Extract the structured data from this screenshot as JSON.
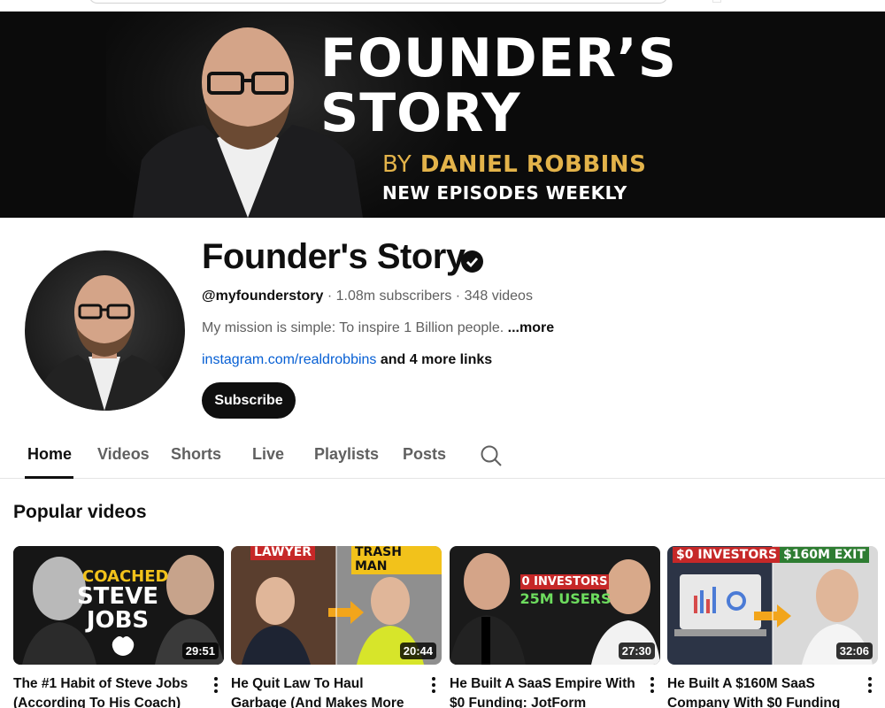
{
  "banner": {
    "title_line1": "FOUNDER’S",
    "title_line2": "STORY",
    "by": "BY",
    "author": "DANIEL ROBBINS",
    "tagline": "NEW EPISODES WEEKLY"
  },
  "channel": {
    "name": "Founder's Story",
    "handle": "@myfounderstory",
    "stats": " · 1.08m subscribers · 348 videos",
    "description": "My mission is simple: To inspire 1 Billion people. ",
    "description_more": "...more",
    "link": "instagram.com/realdrobbins",
    "more_links": " and 4 more links",
    "subscribe_label": "Subscribe"
  },
  "tabs": [
    {
      "label": "Home",
      "active": true
    },
    {
      "label": "Videos"
    },
    {
      "label": "Shorts"
    },
    {
      "label": "Live"
    },
    {
      "label": "Playlists"
    },
    {
      "label": "Posts"
    }
  ],
  "section": {
    "title": "Popular videos"
  },
  "videos": [
    {
      "title": "The #1 Habit of Steve Jobs (According To His Coach)",
      "duration": "29:51",
      "thumb_text1": "COACHED",
      "thumb_text2": "STEVE JOBS"
    },
    {
      "title": "He Quit Law To Haul Garbage (And Makes More Money)",
      "duration": "20:44",
      "tag_left": "LAWYER",
      "tag_right": "TRASH MAN"
    },
    {
      "title": "He Built A SaaS Empire With $0 Funding: JotForm",
      "duration": "27:30",
      "thumb_text1": "0 INVESTORS",
      "thumb_text2": "25M USERS"
    },
    {
      "title": "He Built A $160M SaaS Company With $0 Funding …",
      "duration": "32:06",
      "tag_left": "$0 INVESTORS",
      "tag_right": "$160M EXIT"
    }
  ],
  "colors": {
    "accent_gold": "#e3b34a",
    "link_blue": "#065fd4",
    "tag_red": "#c62828",
    "tag_green": "#2e7d32",
    "tag_yellow": "#f2c21b"
  }
}
